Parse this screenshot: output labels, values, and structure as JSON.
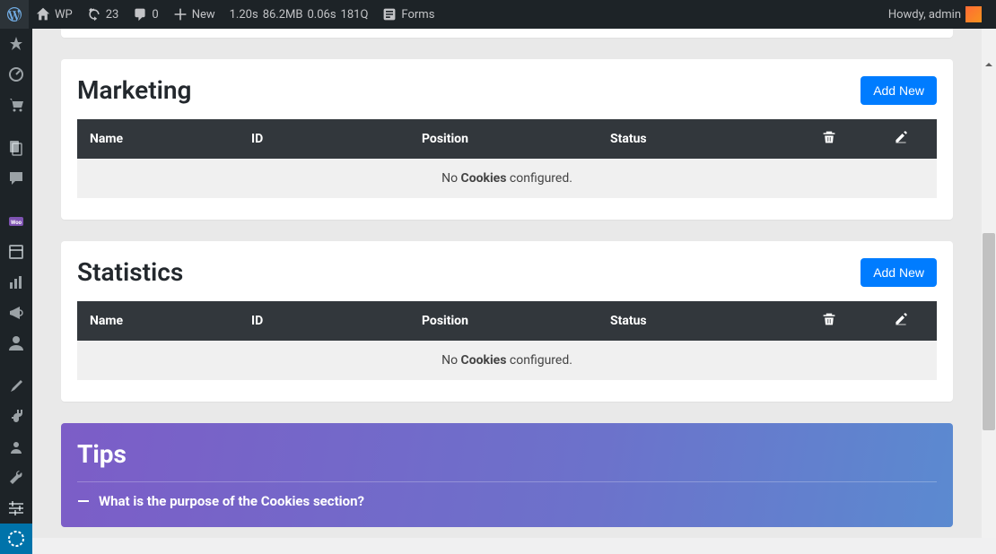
{
  "adminbar": {
    "site": "WP",
    "updates": "23",
    "comments": "0",
    "new": "New",
    "metrics": {
      "time1": "1.20s",
      "mem": "86.2MB",
      "time2": "0.06s",
      "q": "181Q"
    },
    "forms": "Forms",
    "greeting": "Howdy, admin"
  },
  "sections": [
    {
      "title": "Marketing",
      "add_new": "Add New",
      "columns": {
        "name": "Name",
        "id": "ID",
        "position": "Position",
        "status": "Status"
      },
      "empty": {
        "pre": "No ",
        "bold": "Cookies",
        "post": " configured."
      }
    },
    {
      "title": "Statistics",
      "add_new": "Add New",
      "columns": {
        "name": "Name",
        "id": "ID",
        "position": "Position",
        "status": "Status"
      },
      "empty": {
        "pre": "No ",
        "bold": "Cookies",
        "post": " configured."
      }
    }
  ],
  "tips": {
    "title": "Tips",
    "item1": "What is the purpose of the Cookies section?"
  }
}
